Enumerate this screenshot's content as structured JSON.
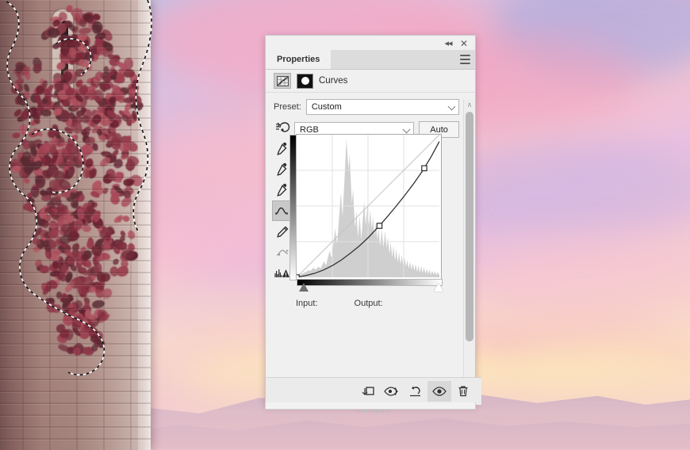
{
  "window": {
    "collapse_label": "◂◂",
    "close_label": "✕"
  },
  "panel": {
    "tab_label": "Properties",
    "menu_icon": "hamburger-menu-icon",
    "adjustment_title": "Curves",
    "adjustment_icon": "curves-grid-icon",
    "mask_icon": "layer-mask-thumbnail"
  },
  "controls": {
    "preset_label": "Preset:",
    "preset_value": "Custom",
    "channel_value": "RGB",
    "auto_label": "Auto",
    "input_label": "Input:",
    "output_label": "Output:",
    "input_value": "",
    "output_value": ""
  },
  "tools": [
    {
      "name": "on-image-adjustment-icon",
      "glyph": "☞",
      "selected": false
    },
    {
      "name": "black-point-eyedropper-icon",
      "glyph": "✐",
      "selected": false
    },
    {
      "name": "gray-point-eyedropper-icon",
      "glyph": "✐",
      "selected": false
    },
    {
      "name": "white-point-eyedropper-icon",
      "glyph": "✐",
      "selected": false
    },
    {
      "name": "curve-edit-tool-icon",
      "glyph": "∿",
      "selected": true
    },
    {
      "name": "pencil-draw-curve-icon",
      "glyph": "✎",
      "selected": false
    },
    {
      "name": "smooth-curve-icon",
      "glyph": "⤳",
      "selected": false
    },
    {
      "name": "histogram-clipping-warning-icon",
      "glyph": "⚠",
      "selected": false
    }
  ],
  "footer_buttons": [
    {
      "name": "clip-to-layer-button",
      "label": "clip-to-layer-icon",
      "active": false
    },
    {
      "name": "view-previous-state-button",
      "label": "eye-previous-state-icon",
      "active": false
    },
    {
      "name": "reset-adjustment-button",
      "label": "reset-arrow-icon",
      "active": false
    },
    {
      "name": "toggle-layer-visibility-button",
      "label": "eye-icon",
      "active": true
    },
    {
      "name": "delete-adjustment-layer-button",
      "label": "trash-icon",
      "active": false
    }
  ],
  "scrollbar": {
    "up_arrow": "∧",
    "down_arrow": "∨"
  },
  "chart_data": {
    "type": "line",
    "title": "Curves (RGB)",
    "xlabel": "Input",
    "ylabel": "Output",
    "xlim": [
      0,
      255
    ],
    "ylim": [
      0,
      255
    ],
    "grid": true,
    "grid_divisions": 4,
    "baseline": {
      "name": "identity-diagonal",
      "points": [
        [
          0,
          0
        ],
        [
          255,
          255
        ]
      ]
    },
    "series": [
      {
        "name": "rgb-curve",
        "control_points": [
          [
            0,
            0
          ],
          [
            148,
            92
          ],
          [
            228,
            195
          ]
        ],
        "points": [
          [
            0,
            0
          ],
          [
            16,
            3
          ],
          [
            32,
            7
          ],
          [
            48,
            13
          ],
          [
            64,
            21
          ],
          [
            80,
            31
          ],
          [
            96,
            43
          ],
          [
            112,
            56
          ],
          [
            128,
            71
          ],
          [
            144,
            88
          ],
          [
            160,
            106
          ],
          [
            176,
            125
          ],
          [
            192,
            145
          ],
          [
            208,
            166
          ],
          [
            224,
            189
          ],
          [
            240,
            215
          ],
          [
            255,
            243
          ]
        ]
      }
    ],
    "histogram": {
      "name": "luminance-histogram",
      "bins": [
        2,
        2,
        3,
        3,
        4,
        4,
        5,
        5,
        6,
        6,
        7,
        7,
        8,
        8,
        9,
        9,
        10,
        10,
        11,
        11,
        12,
        12,
        13,
        13,
        12,
        12,
        13,
        14,
        15,
        16,
        17,
        18,
        16,
        15,
        14,
        15,
        16,
        17,
        18,
        19,
        20,
        18,
        17,
        16,
        18,
        20,
        22,
        24,
        26,
        28,
        30,
        26,
        24,
        22,
        26,
        30,
        34,
        38,
        42,
        46,
        50,
        44,
        40,
        36,
        42,
        50,
        58,
        66,
        74,
        82,
        90,
        78,
        70,
        62,
        72,
        86,
        100,
        114,
        128,
        142,
        156,
        140,
        126,
        112,
        130,
        150,
        170,
        190,
        212,
        234,
        255,
        240,
        225,
        210,
        200,
        214,
        228,
        196,
        176,
        156,
        136,
        150,
        164,
        140,
        120,
        100,
        92,
        108,
        124,
        106,
        88,
        74,
        86,
        98,
        112,
        96,
        82,
        70,
        84,
        98,
        112,
        126,
        140,
        124,
        108,
        94,
        108,
        122,
        136,
        120,
        104,
        96,
        110,
        124,
        112,
        98,
        88,
        100,
        112,
        96,
        84,
        76,
        88,
        100,
        90,
        78,
        70,
        80,
        90,
        78,
        66,
        58,
        68,
        78,
        88,
        76,
        64,
        56,
        66,
        76,
        86,
        74,
        62,
        54,
        64,
        74,
        62,
        50,
        44,
        54,
        64,
        54,
        44,
        38,
        48,
        58,
        48,
        38,
        32,
        42,
        52,
        42,
        34,
        28,
        36,
        46,
        38,
        30,
        24,
        32,
        40,
        34,
        26,
        22,
        28,
        36,
        30,
        24,
        20,
        26,
        32,
        26,
        20,
        16,
        22,
        28,
        24,
        18,
        14,
        20,
        26,
        22,
        16,
        12,
        18,
        24,
        20,
        14,
        10,
        16,
        22,
        18,
        12,
        9,
        14,
        20,
        16,
        11,
        8,
        13,
        18,
        14,
        10,
        7,
        11,
        16,
        12,
        9,
        6,
        10,
        14,
        11,
        8,
        5,
        9,
        12,
        10,
        7,
        5,
        8,
        11,
        9,
        6,
        4,
        7,
        10,
        8,
        6,
        4
      ]
    },
    "endpoint_sliders": {
      "black_point": 0,
      "white_point": 255
    }
  },
  "background": {
    "scene": "castle-tower-with-red-ivy-against-pastel-sunset-sky",
    "selection": "marching-ants-selection-outline"
  }
}
